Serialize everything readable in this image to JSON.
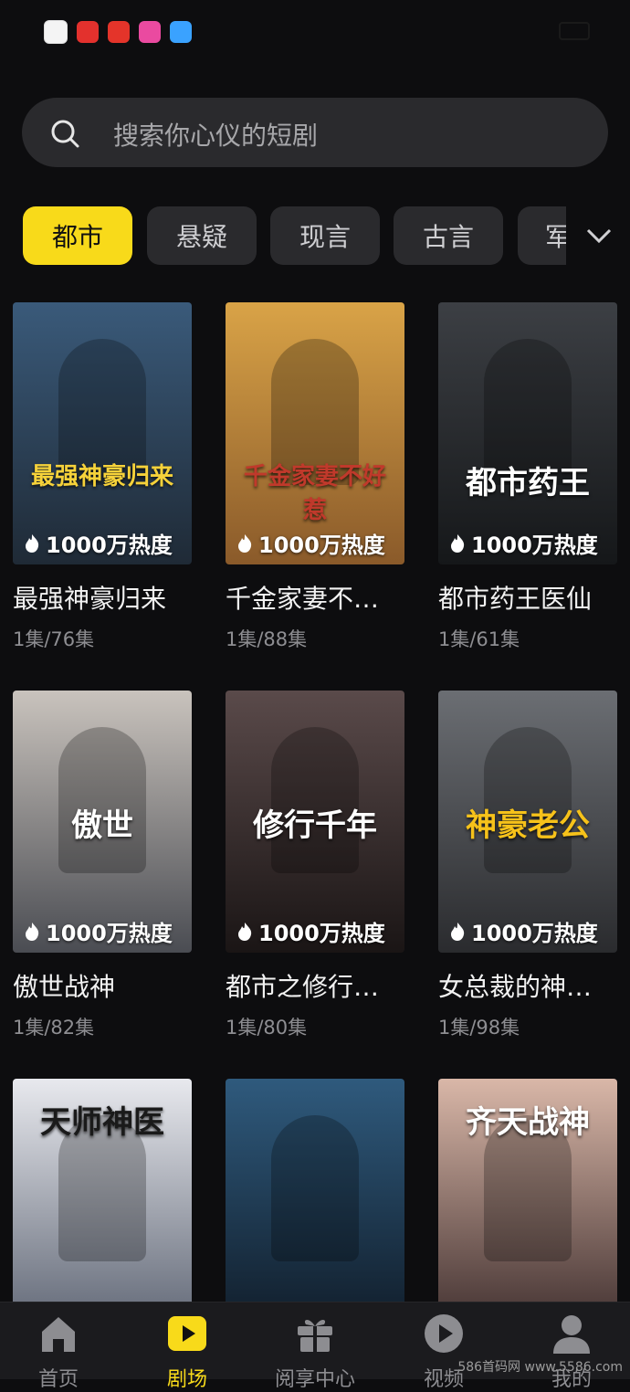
{
  "status_bar": {
    "time": "",
    "right_text": ""
  },
  "search": {
    "placeholder": "搜索你心仪的短剧"
  },
  "categories": [
    "都市",
    "悬疑",
    "现言",
    "古言",
    "军"
  ],
  "heat_label": "1000万热度",
  "dramas": [
    {
      "title": "最强神豪归来",
      "episodes": "1集/76集",
      "poster_text": "最强神豪归来",
      "colors": [
        "#3a5a7a",
        "#1f2a36"
      ]
    },
    {
      "title": "千金家妻不…",
      "episodes": "1集/88集",
      "poster_text": "千金家妻不好惹",
      "colors": [
        "#d9a347",
        "#8a5a2a"
      ]
    },
    {
      "title": "都市药王医仙",
      "episodes": "1集/61集",
      "poster_text": "都市药王",
      "colors": [
        "#3c3f44",
        "#151719"
      ]
    },
    {
      "title": "傲世战神",
      "episodes": "1集/82集",
      "poster_text": "傲世",
      "colors": [
        "#c9c3bd",
        "#4a4c52"
      ]
    },
    {
      "title": "都市之修行…",
      "episodes": "1集/80集",
      "poster_text": "修行千年",
      "colors": [
        "#5a4a4a",
        "#1a1515"
      ]
    },
    {
      "title": "女总裁的神…",
      "episodes": "1集/98集",
      "poster_text": "神豪老公",
      "colors": [
        "#6b6e73",
        "#2a2b2e"
      ]
    },
    {
      "title": "",
      "episodes": "",
      "poster_text": "天师神医",
      "colors": [
        "#e8e9ee",
        "#5a6170"
      ]
    },
    {
      "title": "",
      "episodes": "",
      "poster_text": "",
      "colors": [
        "#2f5a7d",
        "#0f1a26"
      ]
    },
    {
      "title": "",
      "episodes": "",
      "poster_text": "齐天战神",
      "colors": [
        "#d9b7a8",
        "#3a2a2a"
      ]
    }
  ],
  "nav": [
    {
      "label": "首页",
      "icon": "home-icon"
    },
    {
      "label": "剧场",
      "icon": "play-square-icon"
    },
    {
      "label": "阅享中心",
      "icon": "gift-icon"
    },
    {
      "label": "视频",
      "icon": "play-circle-icon"
    },
    {
      "label": "我的",
      "icon": "user-icon"
    }
  ],
  "watermark": "586首码网 www.5586.com",
  "colors": {
    "accent": "#f8da1a",
    "bg": "#0d0d0f",
    "chip": "#2a2a2d"
  }
}
